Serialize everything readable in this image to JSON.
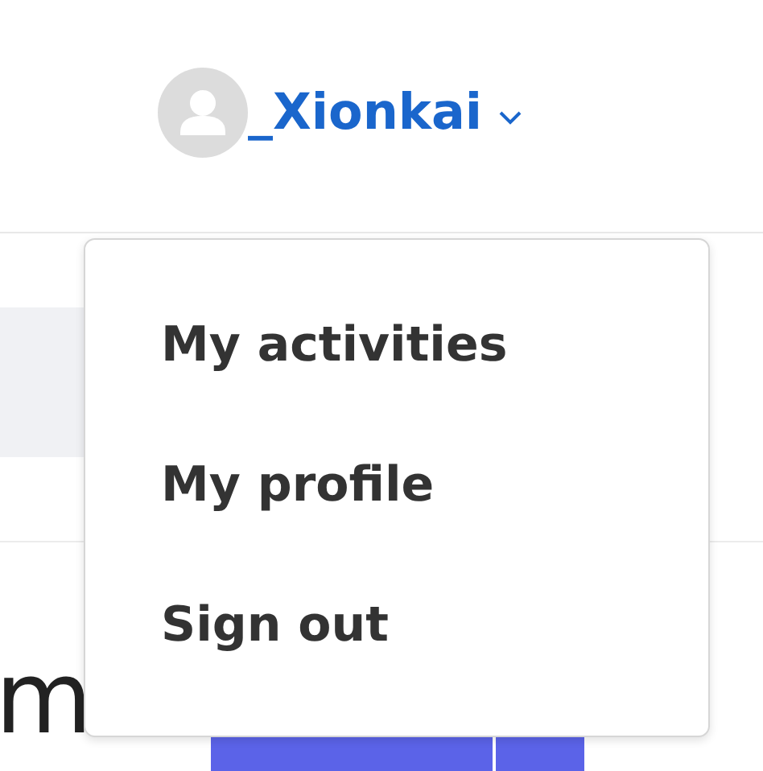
{
  "header": {
    "username": "_Xionkai",
    "menu_expanded": true
  },
  "menu": {
    "items": [
      {
        "label": "My activities"
      },
      {
        "label": "My profile"
      },
      {
        "label": "Sign out"
      }
    ]
  },
  "page": {
    "heading": "m"
  }
}
